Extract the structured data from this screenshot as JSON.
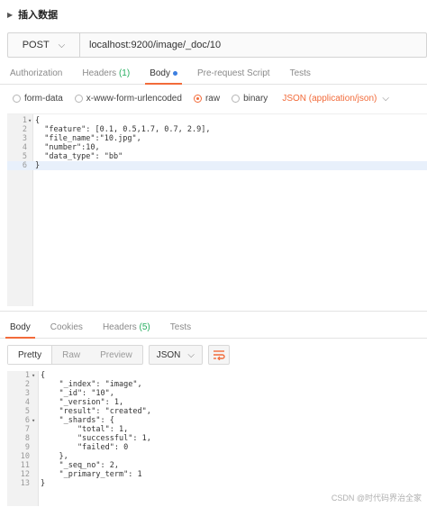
{
  "request_title": "插入数据",
  "method": "POST",
  "url": "localhost:9200/image/_doc/10",
  "request_tabs": [
    {
      "label": "Authorization",
      "count": ""
    },
    {
      "label": "Headers",
      "count": "(1)"
    },
    {
      "label": "Body",
      "count": ""
    },
    {
      "label": "Pre-request Script",
      "count": ""
    },
    {
      "label": "Tests",
      "count": ""
    }
  ],
  "body_options": [
    "form-data",
    "x-www-form-urlencoded",
    "raw",
    "binary"
  ],
  "selected_body_option": "raw",
  "content_type": "JSON (application/json)",
  "request_code": [
    "{",
    "  \"feature\": [0.1, 0.5,1.7, 0.7, 2.9],",
    "  \"file_name\":\"10.jpg\",",
    "  \"number\":10,",
    "  \"data_type\": \"bb\"",
    "}"
  ],
  "response_tabs": [
    {
      "label": "Body",
      "count": ""
    },
    {
      "label": "Cookies",
      "count": ""
    },
    {
      "label": "Headers",
      "count": "(5)"
    },
    {
      "label": "Tests",
      "count": ""
    }
  ],
  "view_modes": [
    "Pretty",
    "Raw",
    "Preview"
  ],
  "response_format": "JSON",
  "wrap_icon": "wrap-lines-icon",
  "response_code": [
    "{",
    "    \"_index\": \"image\",",
    "    \"_id\": \"10\",",
    "    \"_version\": 1,",
    "    \"result\": \"created\",",
    "    \"_shards\": {",
    "        \"total\": 1,",
    "        \"successful\": 1,",
    "        \"failed\": 0",
    "    },",
    "    \"_seq_no\": 2,",
    "    \"_primary_term\": 1",
    "}"
  ],
  "watermark": "CSDN @时代码界治全家",
  "colors": {
    "accent": "#f26b3a",
    "count": "#27ae60",
    "dot": "#3d7fe0"
  }
}
